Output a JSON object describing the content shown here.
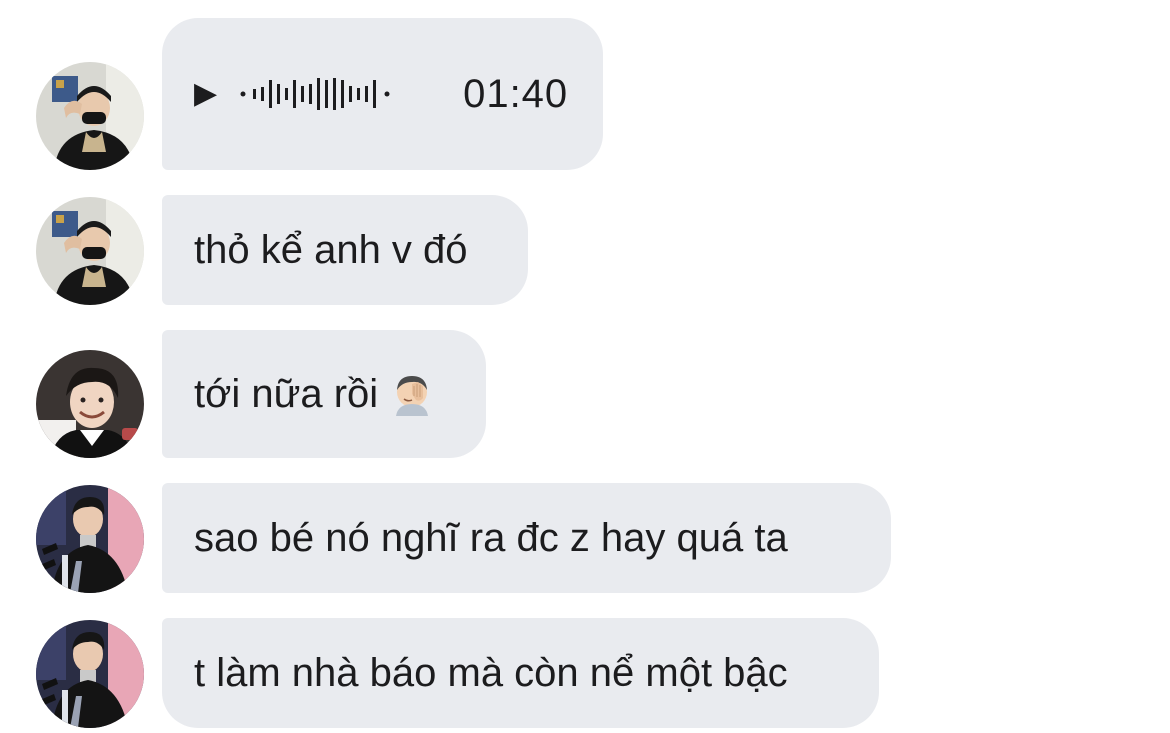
{
  "conversation": {
    "messages": [
      {
        "type": "voice",
        "play_icon": "▶",
        "duration": "01:40"
      },
      {
        "type": "text",
        "text": "thỏ kể anh v đó"
      },
      {
        "type": "text",
        "text": "tới nữa rồi",
        "emoji": "face-palm"
      },
      {
        "type": "text",
        "text": "sao bé nó nghĩ ra đc z hay quá ta"
      },
      {
        "type": "text",
        "text": "t làm nhà báo mà còn nể một bậc"
      }
    ]
  },
  "colors": {
    "bubble_background": "#e9ebef",
    "text": "#1c1c1e",
    "page_background": "#ffffff"
  }
}
